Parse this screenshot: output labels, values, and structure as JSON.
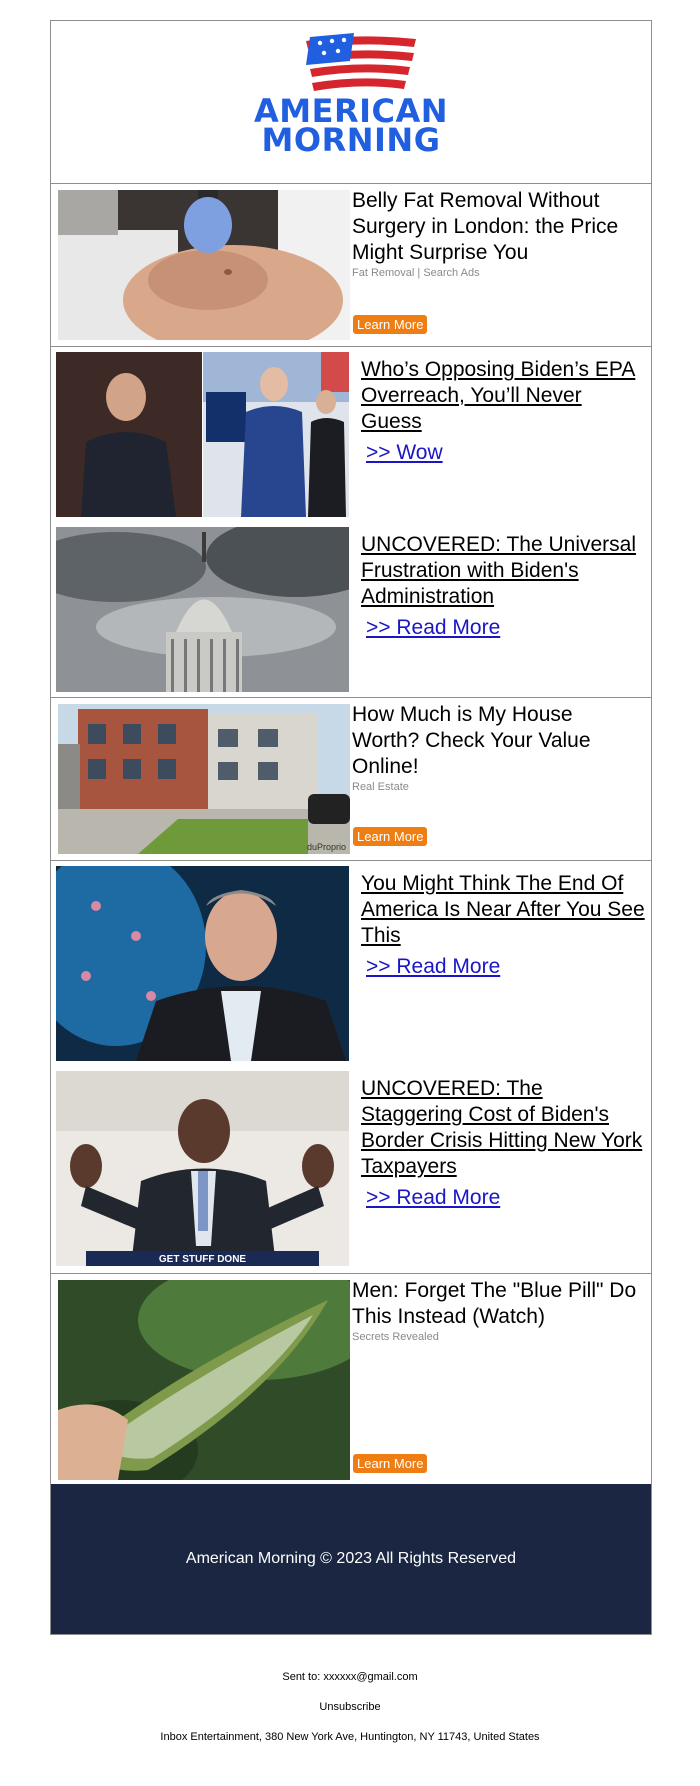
{
  "brand": {
    "name_line1": "AMERICAN",
    "name_line2": "MORNING",
    "blue": "#1f5fe0",
    "red": "#d5252d"
  },
  "ads": [
    {
      "title": "Belly Fat Removal Without Surgery in London: the Price Might Surprise You",
      "source": "Fat Removal | Search Ads",
      "cta": "Learn More",
      "image": "procedure-photo"
    },
    {
      "title": "How Much is My House Worth? Check Your Value Online!",
      "source": "Real Estate",
      "cta": "Learn More",
      "image": "house-photo",
      "watermark": "duProprio"
    },
    {
      "title": "Men: Forget The \"Blue Pill\" Do This Instead (Watch)",
      "source": "Secrets Revealed",
      "cta": "Learn More",
      "image": "aloe-photo"
    }
  ],
  "stories": [
    {
      "headline": "Who’s Opposing Biden’s EPA Overreach, You’ll Never Guess",
      "link": ">> Wow",
      "image": "politicians-photo"
    },
    {
      "headline": "UNCOVERED: The Universal Frustration with Biden's Administration",
      "link": ">> Read More",
      "image": "capitol-photo"
    },
    {
      "headline": "You Might Think The End Of America Is Near After You See This",
      "link": ">> Read More",
      "image": "host-photo"
    },
    {
      "headline": "UNCOVERED: The Staggering Cost of Biden's Border Crisis Hitting New York Taxpayers",
      "link": ">> Read More",
      "image": "mayor-photo",
      "podium_text": "GET STUFF DONE"
    }
  ],
  "footer": {
    "copyright": "American Morning © 2023 All Rights Reserved",
    "sent_to": "Sent to: xxxxxx@gmail.com",
    "unsubscribe": "Unsubscribe",
    "address": "Inbox Entertainment, 380 New York Ave, Huntington, NY 11743, United States",
    "band_color": "#1b2642"
  },
  "accent": {
    "cta": "#ee7d14",
    "link": "#1a16c8"
  }
}
